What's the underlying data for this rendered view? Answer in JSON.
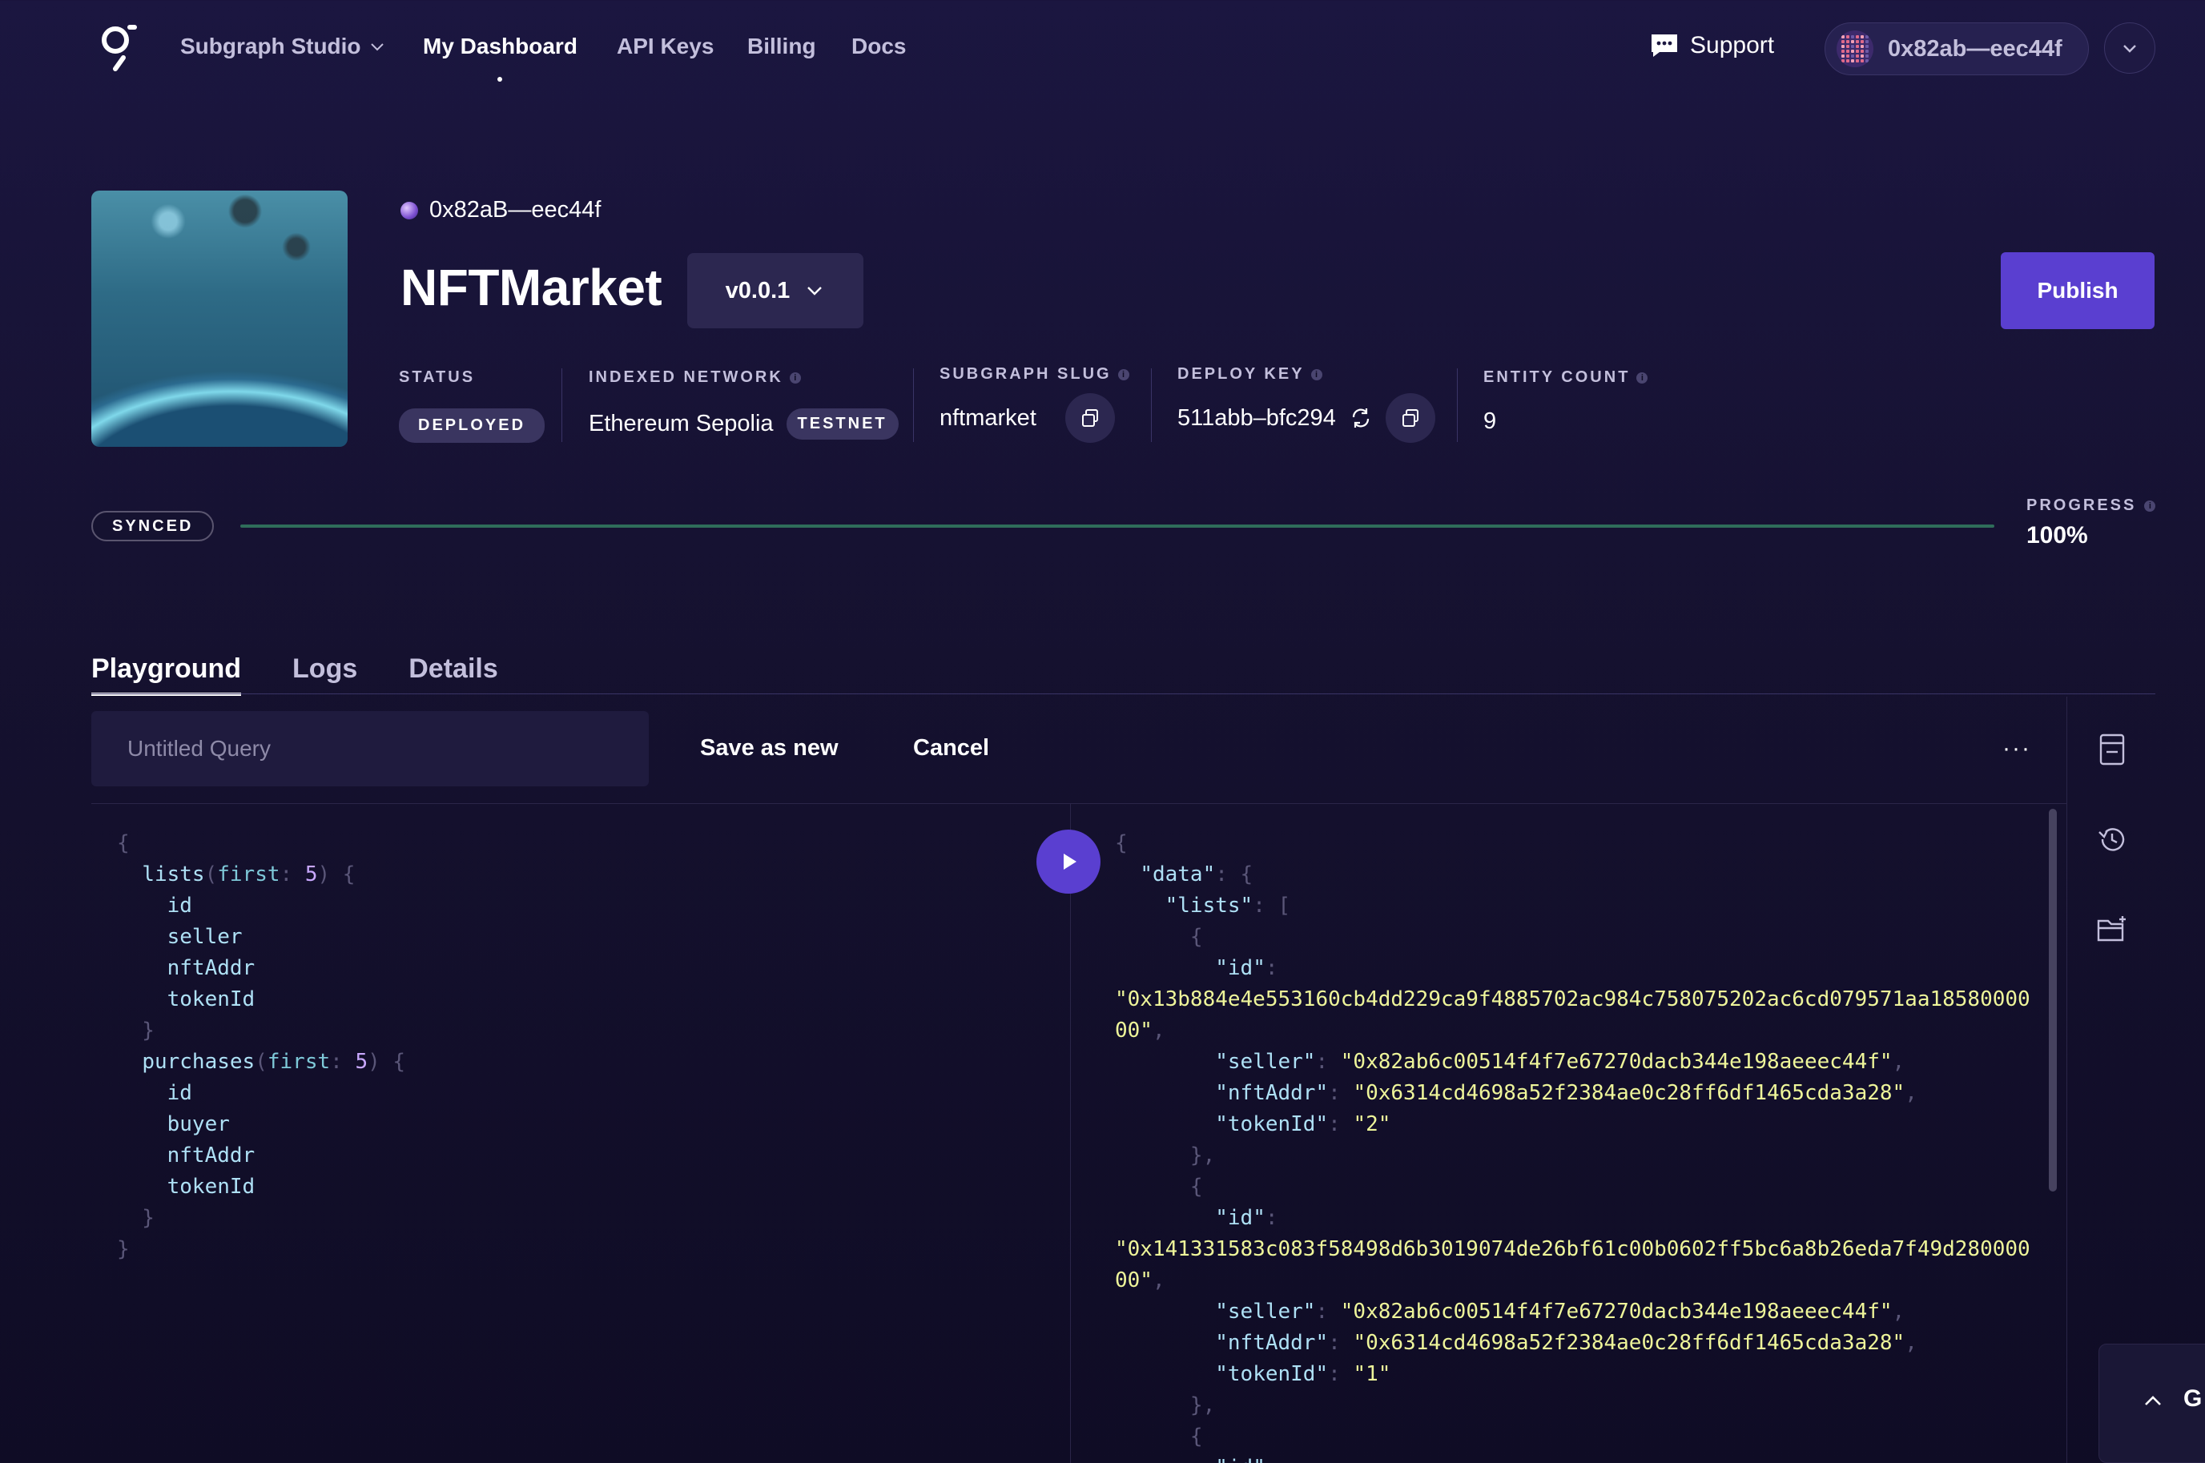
{
  "nav": {
    "studio_label": "Subgraph Studio",
    "dashboard_label": "My Dashboard",
    "api_keys_label": "API Keys",
    "billing_label": "Billing",
    "docs_label": "Docs",
    "support_label": "Support",
    "account_label": "0x82ab—eec44f"
  },
  "subgraph": {
    "owner": "0x82aB—eec44f",
    "name": "NFTMarket",
    "version": "v0.0.1",
    "publish_label": "Publish"
  },
  "meta": {
    "status_label": "STATUS",
    "status_value": "DEPLOYED",
    "network_label": "INDEXED NETWORK",
    "network_value": "Ethereum Sepolia",
    "network_badge": "TESTNET",
    "slug_label": "SUBGRAPH SLUG",
    "slug_value": "nftmarket",
    "deploy_key_label": "DEPLOY KEY",
    "deploy_key_value": "511abb–bfc294",
    "entity_count_label": "ENTITY COUNT",
    "entity_count_value": "9"
  },
  "sync": {
    "status": "SYNCED",
    "progress_label": "PROGRESS",
    "progress_value": "100%",
    "progress_fraction": 1.0
  },
  "tabs": [
    {
      "label": "Playground",
      "active": true
    },
    {
      "label": "Logs",
      "active": false
    },
    {
      "label": "Details",
      "active": false
    }
  ],
  "toolbar": {
    "query_placeholder": "Untitled Query",
    "save_label": "Save as new",
    "cancel_label": "Cancel",
    "more_label": "···"
  },
  "query": {
    "lists_field": "lists",
    "purchases_field": "purchases",
    "arg_name": "first",
    "arg_value": "5",
    "lists_fields": [
      "id",
      "seller",
      "nftAddr",
      "tokenId"
    ],
    "purchases_fields": [
      "id",
      "buyer",
      "nftAddr",
      "tokenId"
    ]
  },
  "result": {
    "data_key": "\"data\"",
    "lists_key": "\"lists\"",
    "id_key": "\"id\"",
    "seller_key": "\"seller\"",
    "nftaddr_key": "\"nftAddr\"",
    "tokenid_key": "\"tokenId\"",
    "items": [
      {
        "id_line1": "\"0x13b884e4e553160cb4dd229ca9f4885702ac984c758075202ac6cd079571aa18580000",
        "id_line2": "00\"",
        "seller": "\"0x82ab6c00514f4f7e67270dacb344e198aeeec44f\"",
        "nftAddr": "\"0x6314cd4698a52f2384ae0c28ff6df1465cda3a28\"",
        "tokenId": "\"2\""
      },
      {
        "id_line1": "\"0x141331583c083f58498d6b3019074de26bf61c00b0602ff5bc6a8b26eda7f49d280000",
        "id_line2": "00\"",
        "seller": "\"0x82ab6c00514f4f7e67270dacb344e198aeeec44f\"",
        "nftAddr": "\"0x6314cd4698a52f2384ae0c28ff6df1465cda3a28\"",
        "tokenId": "\"1\""
      }
    ],
    "trailing_key": "\"id\""
  },
  "corner_widget": {
    "label": "G"
  },
  "colors": {
    "accent": "#5a3fd0",
    "background": "#15112f",
    "progress": "#2f6d5a"
  }
}
